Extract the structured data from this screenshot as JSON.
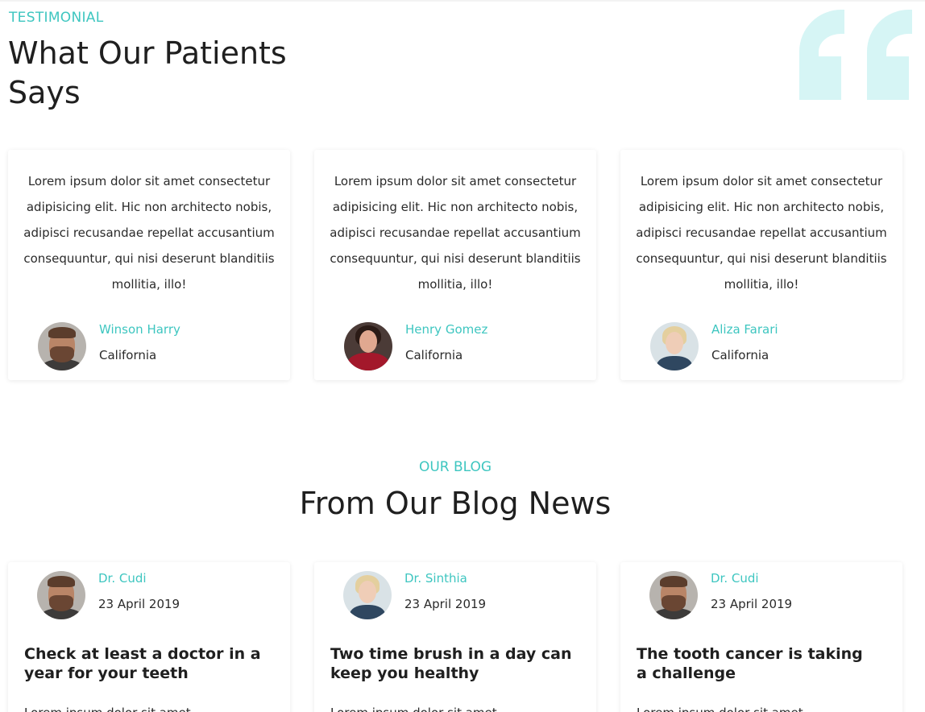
{
  "testimonial": {
    "eyebrow": "TESTIMONIAL",
    "title": "What Our Patients Says",
    "items": [
      {
        "text": "Lorem ipsum dolor sit amet consectetur adipisicing elit. Hic non architecto nobis, adipisci recusandae repellat accusantium consequuntur, qui nisi deserunt blanditiis mollitia, illo!",
        "name": "Winson Harry",
        "location": "California"
      },
      {
        "text": "Lorem ipsum dolor sit amet consectetur adipisicing elit. Hic non architecto nobis, adipisci recusandae repellat accusantium consequuntur, qui nisi deserunt blanditiis mollitia, illo!",
        "name": "Henry Gomez",
        "location": "California"
      },
      {
        "text": "Lorem ipsum dolor sit amet consectetur adipisicing elit. Hic non architecto nobis, adipisci recusandae repellat accusantium consequuntur, qui nisi deserunt blanditiis mollitia, illo!",
        "name": "Aliza Farari",
        "location": "California"
      }
    ]
  },
  "blog": {
    "eyebrow": "OUR BLOG",
    "title": "From Our Blog News",
    "posts": [
      {
        "author": "Dr. Cudi",
        "date": "23 April 2019",
        "title": "Check at least a doctor in a year for your teeth",
        "excerpt": "Lorem ipsum dolor sit amet"
      },
      {
        "author": "Dr. Sinthia",
        "date": "23 April 2019",
        "title": "Two time brush in a day can keep you healthy",
        "excerpt": "Lorem ipsum dolor sit amet"
      },
      {
        "author": "Dr. Cudi",
        "date": "23 April 2019",
        "title": "The tooth cancer is taking a challenge",
        "excerpt": "Lorem ipsum dolor sit amet"
      }
    ]
  },
  "colors": {
    "accent": "#3ec6c0",
    "quote_mark": "#d6f5f5",
    "heading": "#1f1f1f"
  },
  "icons": {
    "quote": "quote-icon"
  }
}
